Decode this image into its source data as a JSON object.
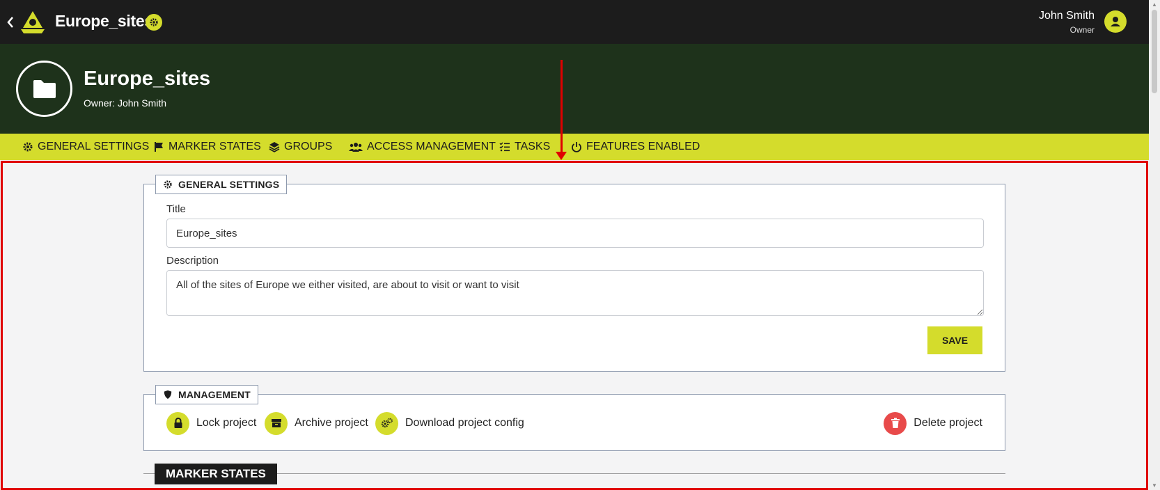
{
  "header": {
    "back_icon": "chevron-left-icon",
    "app_title": "Europe_sites",
    "user_name": "John Smith",
    "user_role": "Owner"
  },
  "banner": {
    "title": "Europe_sites",
    "owner": "Owner: John Smith"
  },
  "tabs": [
    {
      "label": "GENERAL SETTINGS",
      "icon": "gear-icon"
    },
    {
      "label": "MARKER STATES",
      "icon": "flag-icon"
    },
    {
      "label": "GROUPS",
      "icon": "layers-icon"
    },
    {
      "label": "ACCESS MANAGEMENT",
      "icon": "users-icon"
    },
    {
      "label": "TASKS",
      "icon": "checklist-icon"
    },
    {
      "label": "FEATURES ENABLED",
      "icon": "power-icon"
    }
  ],
  "general": {
    "legend": "GENERAL SETTINGS",
    "title_label": "Title",
    "title_value": "Europe_sites",
    "description_label": "Description",
    "description_value": "All of the sites of Europe we either visited, are about to visit or want to visit",
    "save_label": "SAVE"
  },
  "management": {
    "legend": "MANAGEMENT",
    "items": [
      {
        "label": "Lock project",
        "icon": "lock-icon"
      },
      {
        "label": "Archive project",
        "icon": "archive-icon"
      },
      {
        "label": "Download project config",
        "icon": "gears-icon"
      },
      {
        "label": "Delete project",
        "icon": "trash-icon"
      }
    ]
  },
  "marker_states": {
    "heading": "MARKER STATES"
  },
  "colors": {
    "accent": "#d4dc2c",
    "topbar": "#1c1c1c",
    "banner": "#1e321b",
    "danger": "#e84a4a",
    "annotation": "#e00000"
  }
}
